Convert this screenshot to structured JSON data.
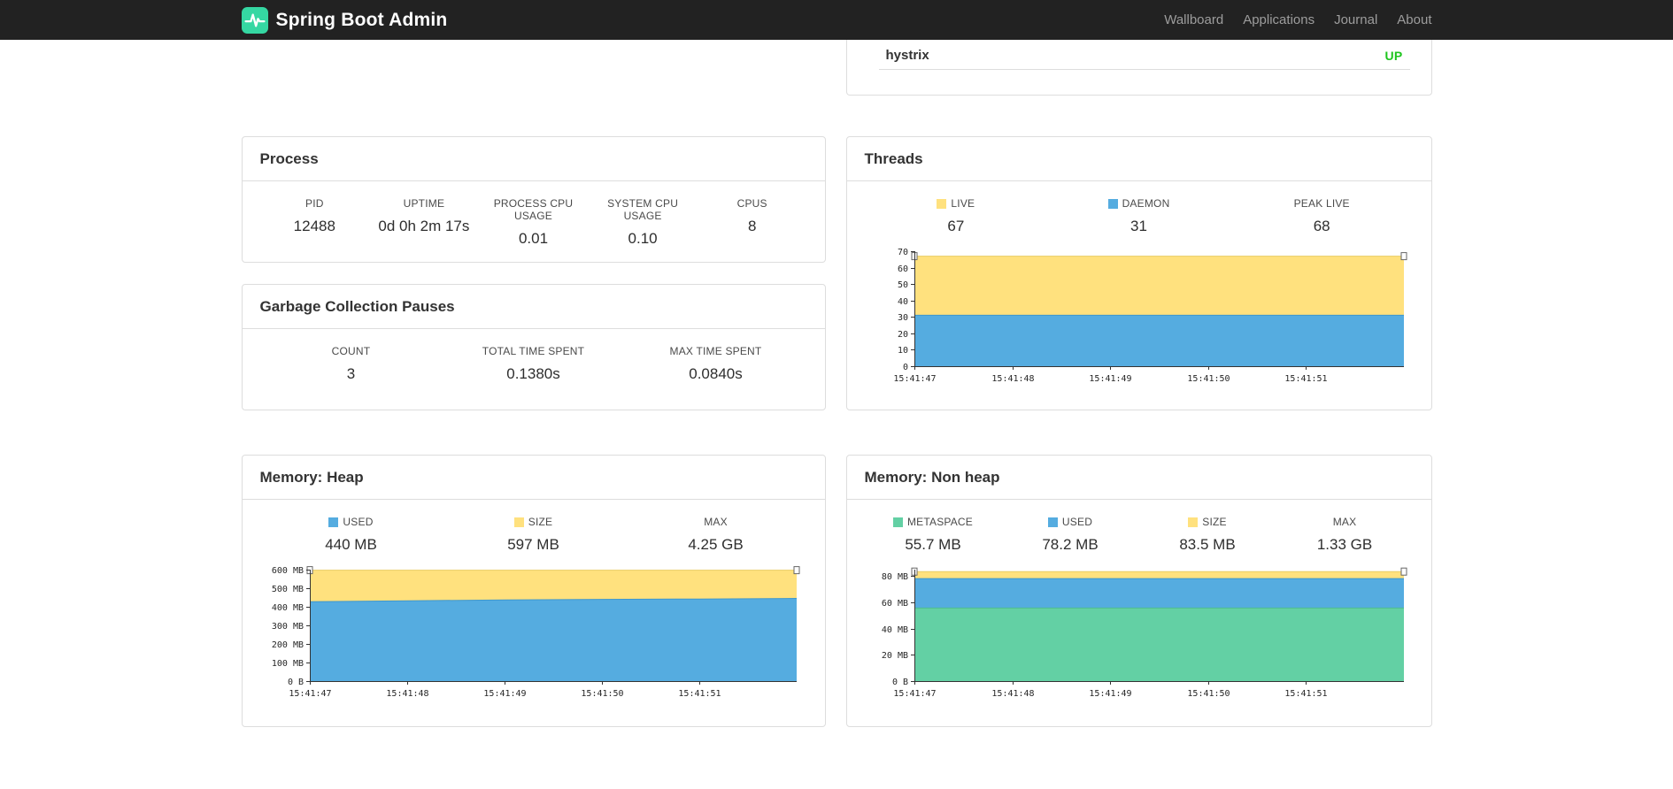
{
  "navbar": {
    "brand": "Spring Boot Admin",
    "links": [
      {
        "label": "Wallboard"
      },
      {
        "label": "Applications"
      },
      {
        "label": "Journal"
      },
      {
        "label": "About"
      }
    ]
  },
  "health_panel": {
    "rows": [
      {
        "name": "hystrix",
        "status": "UP"
      }
    ]
  },
  "process_panel": {
    "title": "Process",
    "stats": [
      {
        "label": "PID",
        "value": "12488"
      },
      {
        "label": "UPTIME",
        "value": "0d 0h 2m 17s"
      },
      {
        "label": "PROCESS CPU USAGE",
        "value": "0.01"
      },
      {
        "label": "SYSTEM CPU USAGE",
        "value": "0.10"
      },
      {
        "label": "CPUS",
        "value": "8"
      }
    ]
  },
  "gc_panel": {
    "title": "Garbage Collection Pauses",
    "stats": [
      {
        "label": "COUNT",
        "value": "3"
      },
      {
        "label": "TOTAL TIME SPENT",
        "value": "0.1380s"
      },
      {
        "label": "MAX TIME SPENT",
        "value": "0.0840s"
      }
    ]
  },
  "threads_panel": {
    "title": "Threads",
    "stats": [
      {
        "label": "LIVE",
        "value": "67",
        "color": "#ffe17e"
      },
      {
        "label": "DAEMON",
        "value": "31",
        "color": "#55ace0"
      },
      {
        "label": "PEAK LIVE",
        "value": "68"
      }
    ]
  },
  "heap_panel": {
    "title": "Memory: Heap",
    "stats": [
      {
        "label": "USED",
        "value": "440 MB",
        "color": "#55ace0"
      },
      {
        "label": "SIZE",
        "value": "597 MB",
        "color": "#ffe17e"
      },
      {
        "label": "MAX",
        "value": "4.25 GB"
      }
    ]
  },
  "nonheap_panel": {
    "title": "Memory: Non heap",
    "stats": [
      {
        "label": "METASPACE",
        "value": "55.7 MB",
        "color": "#63d0a4"
      },
      {
        "label": "USED",
        "value": "78.2 MB",
        "color": "#55ace0"
      },
      {
        "label": "SIZE",
        "value": "83.5 MB",
        "color": "#ffe17e"
      },
      {
        "label": "MAX",
        "value": "1.33 GB"
      }
    ]
  },
  "colors": {
    "status_up": "#1dc51d",
    "accent_teal": "#35d7a2",
    "chart_blue": "#55ace0",
    "chart_yellow": "#ffe17e",
    "chart_green": "#63d0a4"
  },
  "chart_data": [
    {
      "id": "threads",
      "type": "area",
      "title": "Threads",
      "x_labels": [
        "15:41:47",
        "15:41:48",
        "15:41:49",
        "15:41:50",
        "15:41:51"
      ],
      "x_range": [
        0,
        5
      ],
      "ylim": [
        0,
        70
      ],
      "yticks": [
        0,
        10,
        20,
        30,
        40,
        50,
        60,
        70
      ],
      "ytick_labels": [
        "0",
        "10",
        "20",
        "30",
        "40",
        "50",
        "60",
        "70"
      ],
      "legend": [
        {
          "name": "LIVE",
          "value": 67
        },
        {
          "name": "DAEMON",
          "value": 31
        },
        {
          "name": "PEAK LIVE",
          "value": 68
        }
      ],
      "series": [
        {
          "name": "LIVE",
          "color": "#ffe17e",
          "stroke": "#e9cd62",
          "values": [
            67,
            67,
            67,
            67,
            67,
            67
          ]
        },
        {
          "name": "DAEMON",
          "color": "#55ace0",
          "stroke": "#3f97cc",
          "values": [
            31,
            31,
            31,
            31,
            31,
            31
          ]
        }
      ],
      "series_note": "absolute values, drawn back-to-front for stacked look",
      "grid": false,
      "legend_position": "top"
    },
    {
      "id": "memory-heap",
      "type": "area",
      "title": "Memory: Heap",
      "x_labels": [
        "15:41:47",
        "15:41:48",
        "15:41:49",
        "15:41:50",
        "15:41:51"
      ],
      "x_range": [
        0,
        5
      ],
      "ylim": [
        0,
        600
      ],
      "yticks": [
        0,
        100,
        200,
        300,
        400,
        500,
        600
      ],
      "ytick_labels": [
        "0 B",
        "100 MB",
        "200 MB",
        "300 MB",
        "400 MB",
        "500 MB",
        "600 MB"
      ],
      "legend": [
        {
          "name": "USED",
          "value": "440 MB"
        },
        {
          "name": "SIZE",
          "value": "597 MB"
        },
        {
          "name": "MAX",
          "value": "4.25 GB"
        }
      ],
      "series": [
        {
          "name": "SIZE",
          "color": "#ffe17e",
          "stroke": "#e9cd62",
          "values": [
            597,
            597,
            597,
            597,
            597,
            597
          ]
        },
        {
          "name": "USED",
          "color": "#55ace0",
          "stroke": "#3f97cc",
          "values": [
            427,
            432,
            437,
            440,
            442,
            445
          ]
        }
      ],
      "grid": false,
      "legend_position": "top"
    },
    {
      "id": "memory-nonheap",
      "type": "area",
      "title": "Memory: Non heap",
      "x_labels": [
        "15:41:47",
        "15:41:48",
        "15:41:49",
        "15:41:50",
        "15:41:51"
      ],
      "x_range": [
        0,
        5
      ],
      "ylim": [
        0,
        85
      ],
      "yticks": [
        0,
        20,
        40,
        60,
        80
      ],
      "ytick_labels": [
        "0 B",
        "20 MB",
        "40 MB",
        "60 MB",
        "80 MB"
      ],
      "legend": [
        {
          "name": "METASPACE",
          "value": "55.7 MB"
        },
        {
          "name": "USED",
          "value": "78.2 MB"
        },
        {
          "name": "SIZE",
          "value": "83.5 MB"
        },
        {
          "name": "MAX",
          "value": "1.33 GB"
        }
      ],
      "series": [
        {
          "name": "SIZE",
          "color": "#ffe17e",
          "stroke": "#e9cd62",
          "values": [
            83.5,
            83.5,
            83.5,
            83.5,
            83.5,
            83.5
          ]
        },
        {
          "name": "USED",
          "color": "#55ace0",
          "stroke": "#3f97cc",
          "values": [
            78.2,
            78.2,
            78.2,
            78.2,
            78.2,
            78.2
          ]
        },
        {
          "name": "METASPACE",
          "color": "#63d0a4",
          "stroke": "#4dbd90",
          "values": [
            55.7,
            55.7,
            55.7,
            55.7,
            55.7,
            55.7
          ]
        }
      ],
      "grid": false,
      "legend_position": "top"
    }
  ]
}
